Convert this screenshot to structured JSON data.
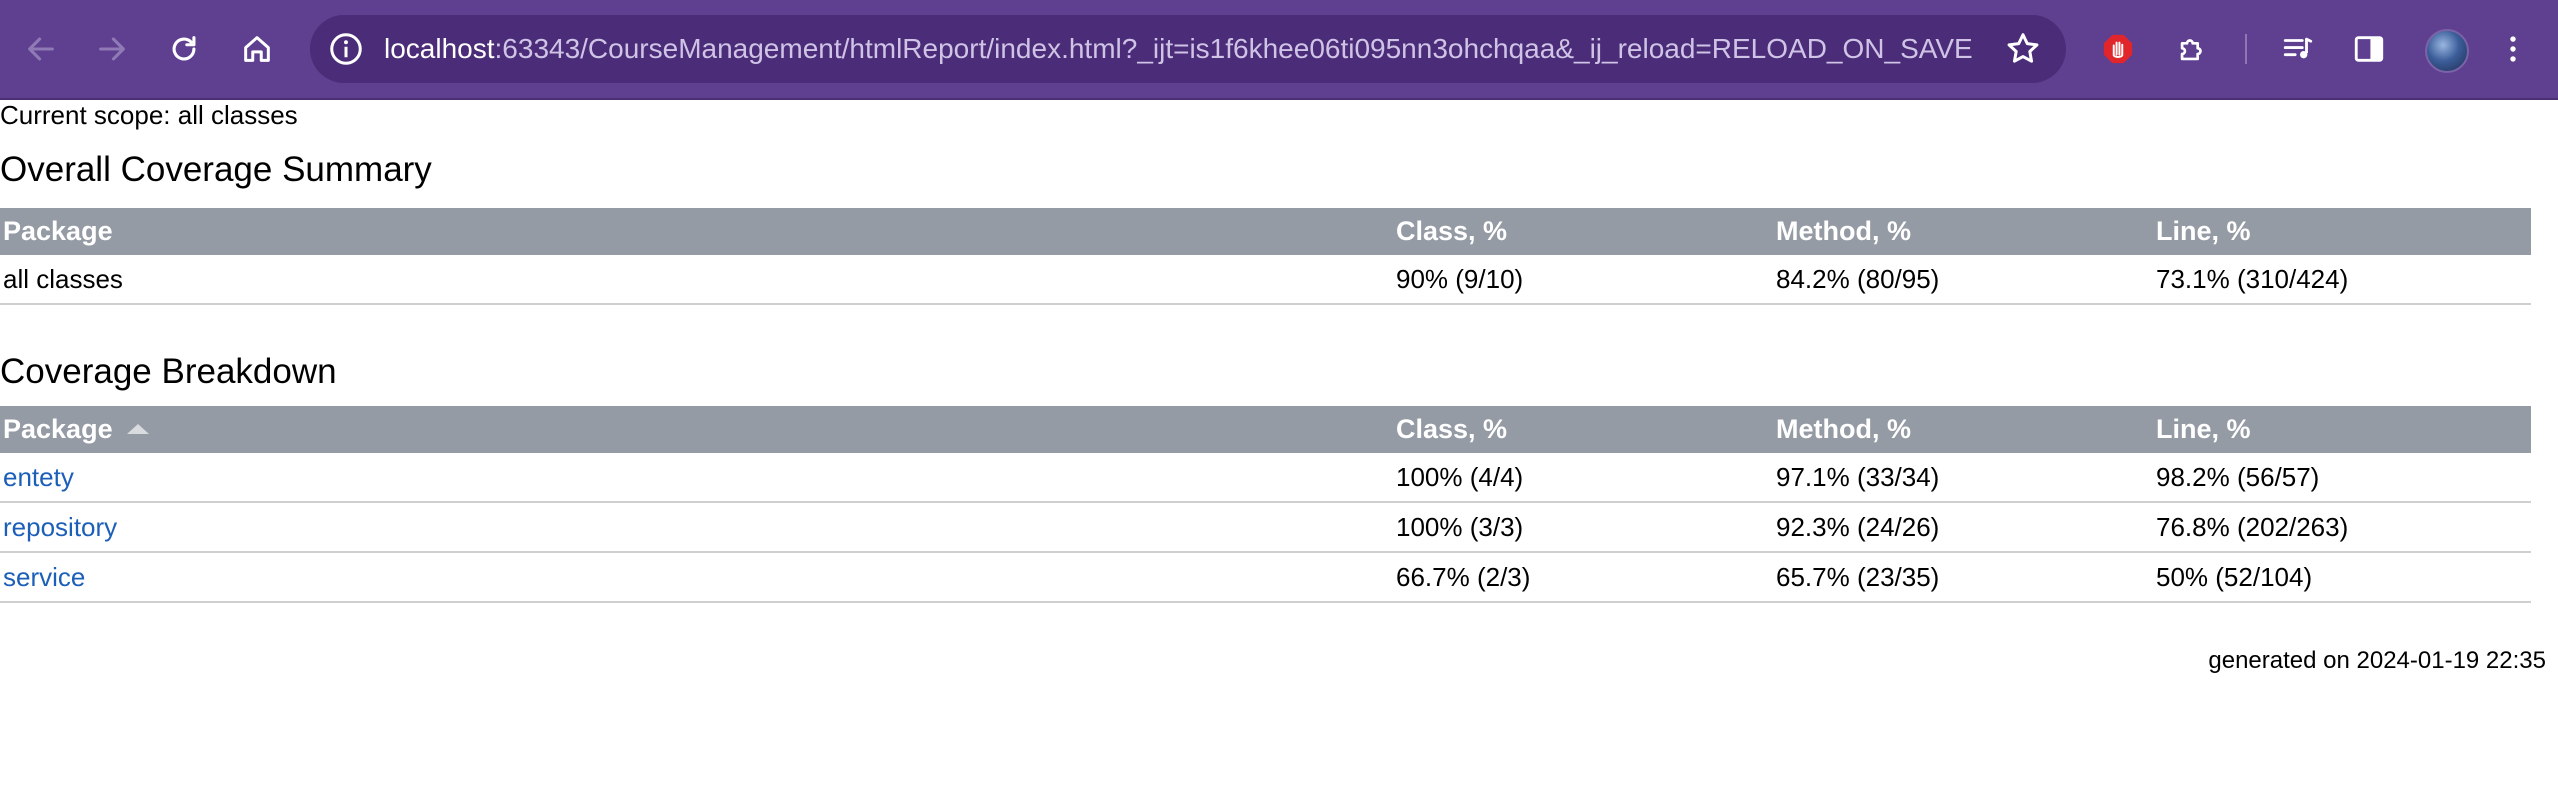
{
  "browser": {
    "url_host": "localhost",
    "url_rest": ":63343/CourseManagement/htmlReport/index.html?_ijt=is1f6khee06ti095nn3ohchqaa&_ij_reload=RELOAD_ON_SAVE"
  },
  "page": {
    "scope": "Current scope: all classes",
    "summary_title": "Overall Coverage Summary",
    "breakdown_title": "Coverage Breakdown",
    "generated": "generated on 2024-01-19 22:35"
  },
  "summary_table": {
    "headers": [
      "Package",
      "Class, %",
      "Method, %",
      "Line, %"
    ],
    "row": {
      "package": "all classes",
      "class": "90% (9/10)",
      "method": "84.2% (80/95)",
      "line": "73.1% (310/424)"
    }
  },
  "breakdown_table": {
    "headers": [
      "Package",
      "Class, %",
      "Method, %",
      "Line, %"
    ],
    "rows": [
      {
        "package": "entety",
        "class": "100% (4/4)",
        "method": "97.1% (33/34)",
        "line": "98.2% (56/57)"
      },
      {
        "package": "repository",
        "class": "100% (3/3)",
        "method": "92.3% (24/26)",
        "line": "76.8% (202/263)"
      },
      {
        "package": "service",
        "class": "66.7% (2/3)",
        "method": "65.7% (23/35)",
        "line": "50% (52/104)"
      }
    ]
  }
}
